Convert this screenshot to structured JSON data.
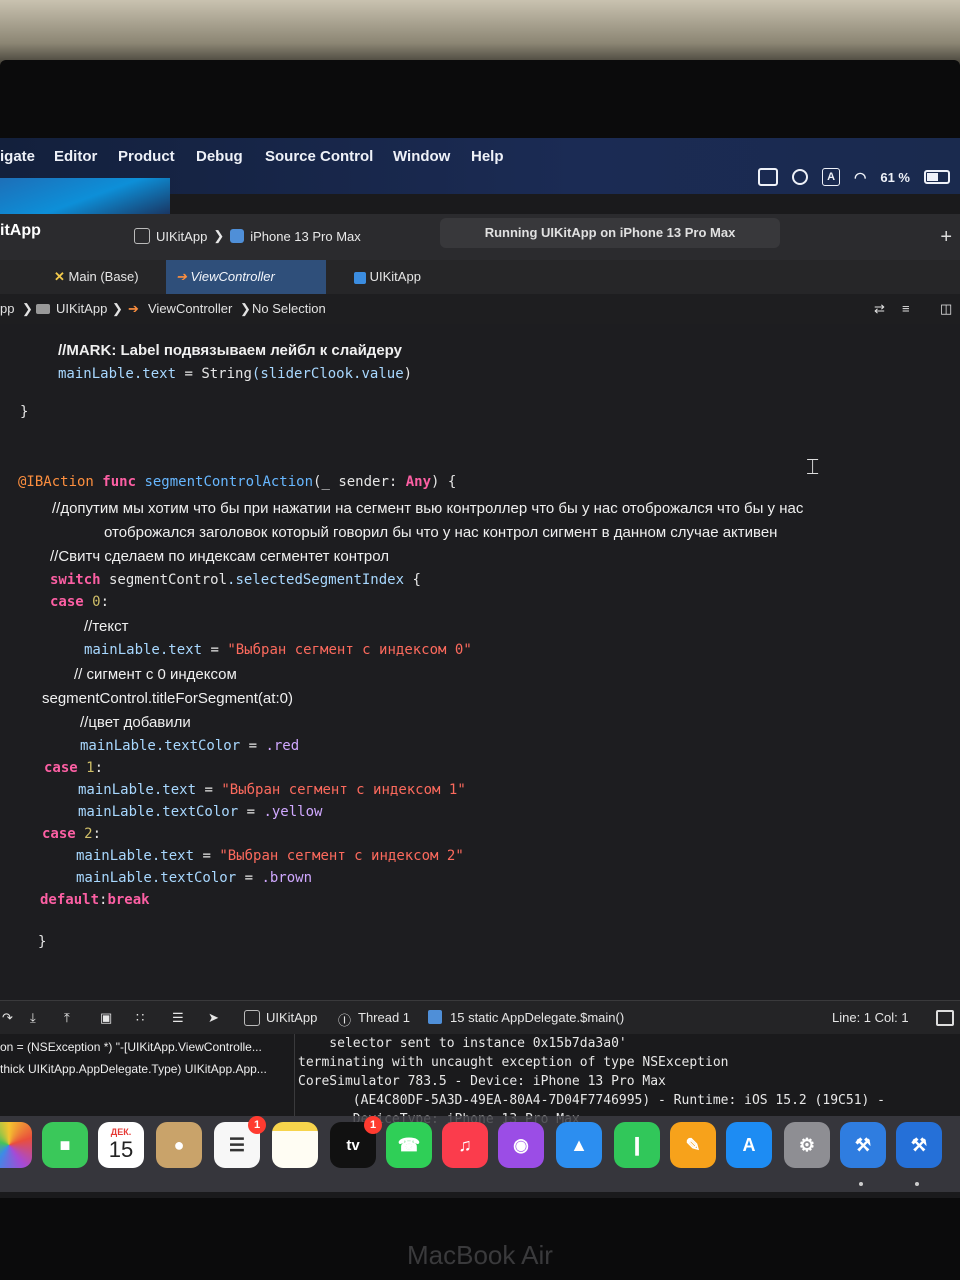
{
  "menubar": {
    "items": [
      "igate",
      "Editor",
      "Product",
      "Debug",
      "Source Control",
      "Window",
      "Help"
    ],
    "battery": "61 %",
    "input_source": "A"
  },
  "toolbar": {
    "app_title": "itApp",
    "scheme_target": "UIKitApp",
    "scheme_device": "iPhone 13 Pro Max",
    "run_status": "Running UIKitApp on iPhone 13 Pro Max",
    "add_label": "+"
  },
  "tabs": [
    {
      "label": "Main (Base)"
    },
    {
      "label": "ViewController"
    },
    {
      "label": "UIKitApp"
    }
  ],
  "jumpbar": {
    "crumbs": [
      "pp",
      "UIKitApp",
      "ViewController",
      "No Selection"
    ]
  },
  "code": {
    "l1a": "//MARK: ",
    "l1b": "Label подвязываем лейбл к слайдеру",
    "l2a": "mainLable",
    "l2b": ".text",
    "l2c": " = ",
    "l2d": "String",
    "l2e": "(sliderClook",
    "l2f": ".value",
    "l2g": ")",
    "l3": "}",
    "l4a": "@IBAction",
    "l4b": " func ",
    "l4c": "segmentControlAction",
    "l4d": "(_ ",
    "l4e": "sender",
    "l4f": ": ",
    "l4g": "Any",
    "l4h": ") {",
    "l5": "//допутим мы хотим что бы при нажатии на сегмент вью контроллер  что бы у нас отоброжался что бы у нас",
    "l6": "отоброжался заголовок который говорил бы что у нас контрол сигмент в данном случае активен",
    "l7": "//Свитч сделаем по индексам сегментет контрол",
    "l8a": "switch",
    "l8b": " segmentControl",
    "l8c": ".selectedSegmentIndex",
    "l8d": " {",
    "l9a": "case",
    "l9b": " 0",
    "l9c": ":",
    "l10": "//текст",
    "l11a": "mainLable",
    "l11b": ".text",
    "l11c": " = ",
    "l11d": "\"Выбран сегмент с индексом 0\"",
    "l12": "// сигмент с 0 индексом",
    "l13": "segmentControl.titleForSegment(at:0)",
    "l14": "//цвет добавили",
    "l15a": "mainLable",
    "l15b": ".textColor",
    "l15c": " = ",
    "l15d": ".red",
    "l16a": "case",
    "l16b": " 1",
    "l16c": ":",
    "l17a": "mainLable",
    "l17b": ".text",
    "l17c": " = ",
    "l17d": "\"Выбран сегмент с индексом 1\"",
    "l18a": "mainLable",
    "l18b": ".textColor",
    "l18c": " = ",
    "l18d": ".yellow",
    "l19a": "case",
    "l19b": " 2",
    "l19c": ":",
    "l20a": "mainLable",
    "l20b": ".text",
    "l20c": " = ",
    "l20d": "\"Выбран сегмент с индексом 2\"",
    "l21a": "mainLable",
    "l21b": ".textColor",
    "l21c": " = ",
    "l21d": ".brown",
    "l22a": "default",
    "l22b": ":",
    "l22c": "break",
    "l23": "}"
  },
  "debugbar": {
    "target": "UIKitApp",
    "thread": "Thread 1",
    "frame": "15 static AppDelegate.$main()",
    "line_col": "Line: 1  Col: 1"
  },
  "console": {
    "vars": [
      "on = (NSException *) \"-[UIKitApp.ViewControlle...",
      "thick UIKitApp.AppDelegate.Type) UIKitApp.App..."
    ],
    "output": [
      "    selector sent to instance 0x15b7da3a0'",
      "terminating with uncaught exception of type NSException",
      "CoreSimulator 783.5 - Device: iPhone 13 Pro Max",
      "       (AE4C80DF-5A3D-49EA-80A4-7D04F7746995) - Runtime: iOS 15.2 (19C51) -",
      "       DeviceType: iPhone 13 Pro Max"
    ]
  },
  "dock": {
    "calendar_month": "ДЕК.",
    "calendar_day": "15",
    "reminders_badge": "1",
    "tv_label": "tv",
    "tv_badge": "1"
  },
  "footer": {
    "brand": "MacBook Air"
  }
}
